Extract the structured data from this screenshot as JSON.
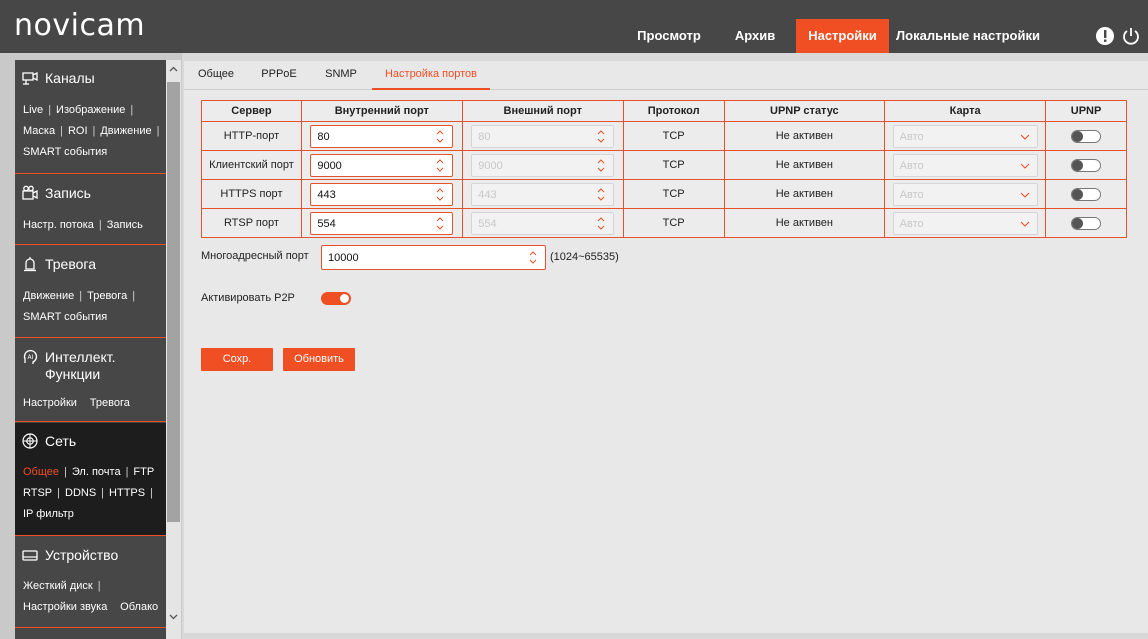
{
  "brand": {
    "logo": "novicam",
    "accent": "#f04e23"
  },
  "header": {
    "nav": [
      {
        "label": "Просмотр",
        "active": false
      },
      {
        "label": "Архив",
        "active": false
      },
      {
        "label": "Настройки",
        "active": true
      },
      {
        "label": "Локальные настройки",
        "active": false
      }
    ],
    "icons": [
      "info-icon",
      "power-icon"
    ]
  },
  "sidebar": {
    "sections": [
      {
        "title": "Каналы",
        "icon": "camera-icon",
        "active": false,
        "rows": [
          [
            "Live",
            "Изображение"
          ],
          [
            "Маска",
            "ROI",
            "Движение"
          ],
          [
            "SMART события"
          ]
        ]
      },
      {
        "title": "Запись",
        "icon": "video-camera-icon",
        "active": false,
        "rows": [
          [
            "Настр. потока",
            "Запись"
          ]
        ]
      },
      {
        "title": "Тревога",
        "icon": "alarm-icon",
        "active": false,
        "rows": [
          [
            "Движение",
            "Тревога"
          ],
          [
            "SMART события"
          ]
        ]
      },
      {
        "title": "Интеллект. Функции",
        "icon": "ai-icon",
        "active": false,
        "rows": [
          [
            "Настройки",
            "Тревога"
          ]
        ]
      },
      {
        "title": "Сеть",
        "icon": "network-icon",
        "active": true,
        "active_link": "Общее",
        "rows": [
          [
            "Общее",
            "Эл. почта",
            "FTP"
          ],
          [
            "RTSP",
            "DDNS",
            "HTTPS"
          ],
          [
            "IP фильтр"
          ]
        ]
      },
      {
        "title": "Устройство",
        "icon": "device-icon",
        "active": false,
        "rows": [
          [
            "Жесткий диск"
          ],
          [
            "Настройки звука",
            "Облако"
          ]
        ]
      }
    ]
  },
  "tabs": [
    {
      "label": "Общее",
      "active": false
    },
    {
      "label": "PPPoE",
      "active": false
    },
    {
      "label": "SNMP",
      "active": false
    },
    {
      "label": "Настройка портов",
      "active": true
    }
  ],
  "ports_table": {
    "headers": [
      "Сервер",
      "Внутренний порт",
      "Внешний порт",
      "Протокол",
      "UPNP статус",
      "Карта",
      "UPNP"
    ],
    "rows": [
      {
        "server": "HTTP-порт",
        "internal": "80",
        "external": "80",
        "protocol": "TCP",
        "status": "Не активен",
        "map": "Авто",
        "upnp": false
      },
      {
        "server": "Клиентский порт",
        "internal": "9000",
        "external": "9000",
        "protocol": "TCP",
        "status": "Не активен",
        "map": "Авто",
        "upnp": false
      },
      {
        "server": "HTTPS порт",
        "internal": "443",
        "external": "443",
        "protocol": "TCP",
        "status": "Не активен",
        "map": "Авто",
        "upnp": false
      },
      {
        "server": "RTSP порт",
        "internal": "554",
        "external": "554",
        "protocol": "TCP",
        "status": "Не активен",
        "map": "Авто",
        "upnp": false
      }
    ]
  },
  "multicast": {
    "label": "Многоадресный порт",
    "value": "10000",
    "range": "(1024~65535)"
  },
  "p2p": {
    "label": "Активировать P2P",
    "enabled": true
  },
  "buttons": {
    "save": "Сохр.",
    "refresh": "Обновить"
  }
}
